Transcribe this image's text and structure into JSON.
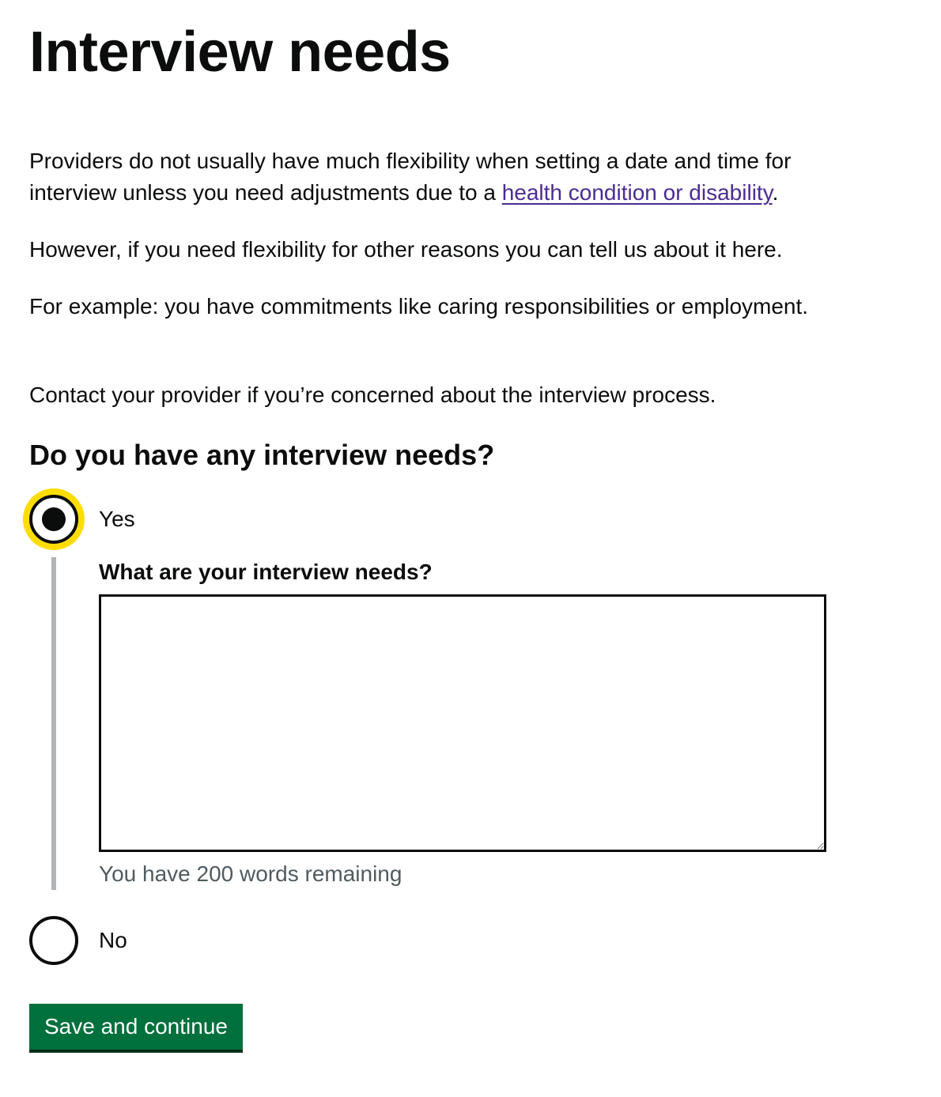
{
  "page_title": "Interview needs",
  "intro": {
    "p1_before_link": "Providers do not usually have much flexibility when setting a date and time for interview unless you need adjustments due to a ",
    "p1_link": "health condition or disability",
    "p1_after_link": ".",
    "p2": "However, if you need flexibility for other reasons you can tell us about it here.",
    "p3": "For example: you have commitments like caring responsibilities or employment.",
    "p4": "Contact your provider if you’re concerned about the interview process."
  },
  "question": {
    "heading": "Do you have any interview needs?",
    "selected": "Yes",
    "options": {
      "yes": "Yes",
      "no": "No"
    },
    "conditional": {
      "label": "What are your interview needs?",
      "value": "",
      "hint": "You have 200 words remaining"
    }
  },
  "actions": {
    "submit_label": "Save and continue"
  },
  "colors": {
    "text": "#0b0c0c",
    "link": "#4c2c92",
    "focus": "#ffdd00",
    "button": "#00703c",
    "hint": "#505a5f",
    "border_bar": "#b1b4b6"
  }
}
